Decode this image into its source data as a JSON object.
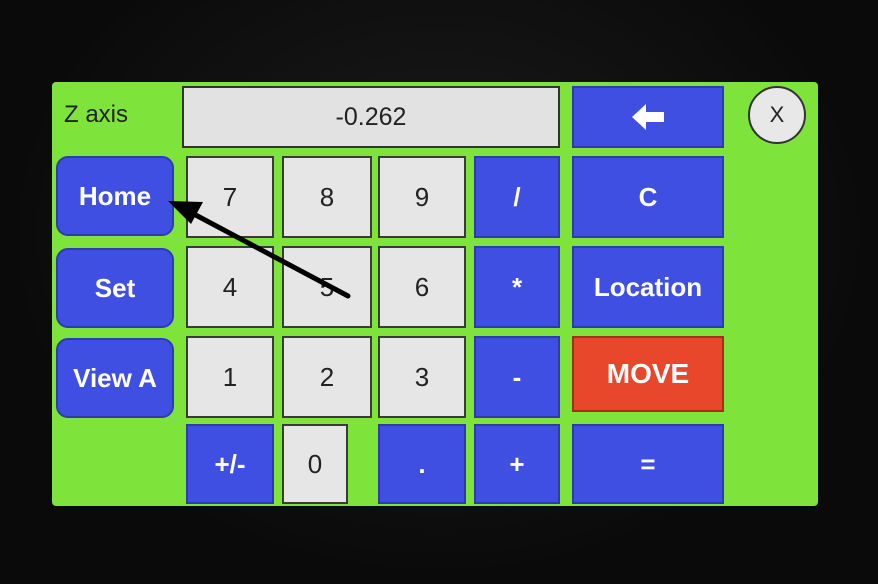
{
  "header": {
    "axis_label": "Z axis",
    "display_value": "-0.262",
    "backspace_icon": "left-arrow-icon",
    "close_label": "X"
  },
  "side_buttons": {
    "home": "Home",
    "set": "Set",
    "view_a": "View A"
  },
  "keypad": {
    "row1": [
      "7",
      "8",
      "9",
      "/"
    ],
    "row2": [
      "4",
      "5",
      "6",
      "*"
    ],
    "row3": [
      "1",
      "2",
      "3",
      "-"
    ],
    "row4": [
      "+/-",
      "0",
      ".",
      "+"
    ]
  },
  "right_buttons": {
    "clear": "C",
    "location": "Location",
    "move": "MOVE",
    "equals": "="
  },
  "colors": {
    "screen_bg": "#7ee33a",
    "button_blue": "#3f4fe2",
    "button_red": "#e8472b",
    "key_white": "#e6e6e6"
  }
}
